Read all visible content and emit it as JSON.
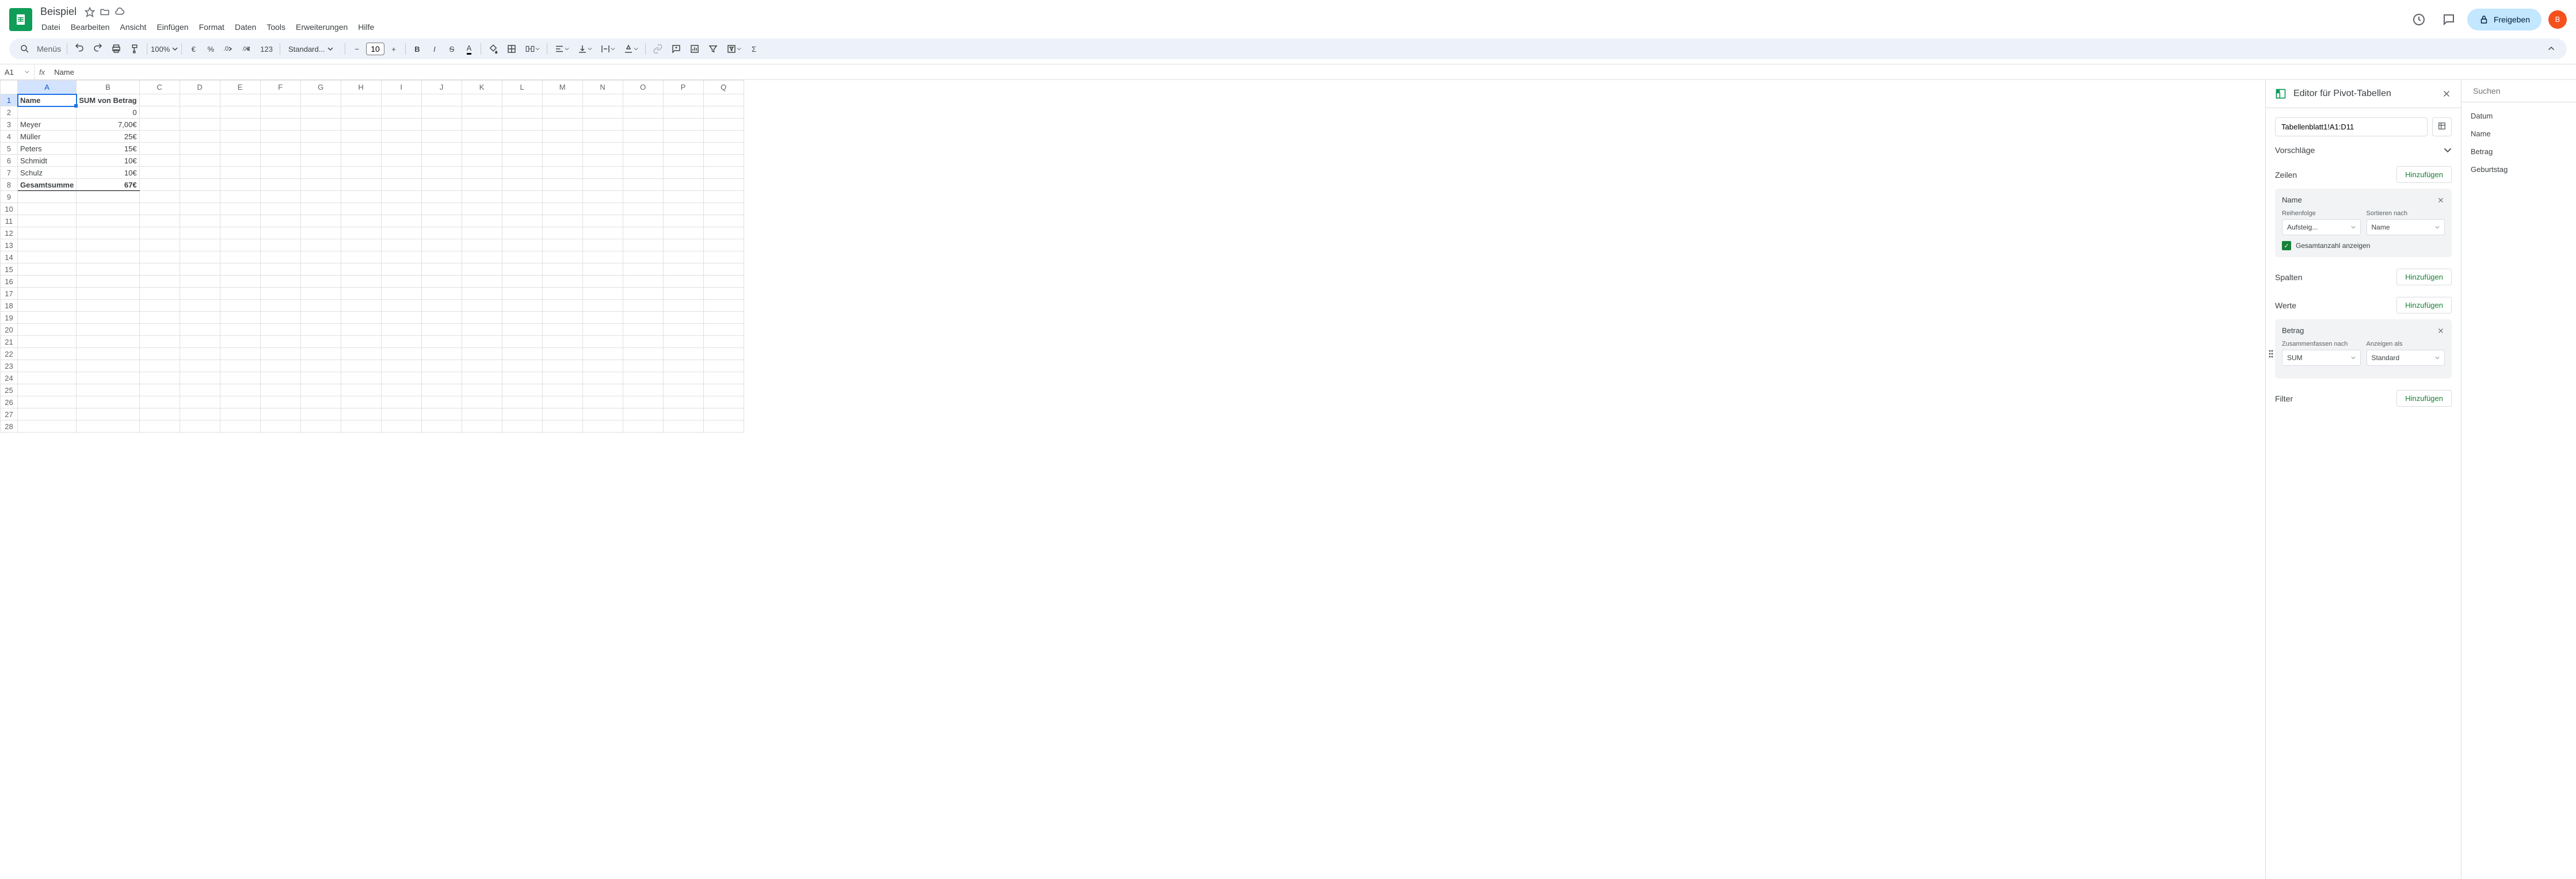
{
  "header": {
    "doc_title": "Beispiel",
    "menus": [
      "Datei",
      "Bearbeiten",
      "Ansicht",
      "Einfügen",
      "Format",
      "Daten",
      "Tools",
      "Erweiterungen",
      "Hilfe"
    ],
    "share_label": "Freigeben",
    "avatar_letter": "B"
  },
  "toolbar": {
    "search_placeholder": "Menüs",
    "zoom": "100%",
    "font": "Standard...",
    "font_size": "10"
  },
  "formula_bar": {
    "name_box": "A1",
    "formula": "Name"
  },
  "columns": [
    "A",
    "B",
    "C",
    "D",
    "E",
    "F",
    "G",
    "H",
    "I",
    "J",
    "K",
    "L",
    "M",
    "N",
    "O",
    "P",
    "Q"
  ],
  "rows": {
    "count": 28,
    "data": [
      {
        "r": 1,
        "a": "Name",
        "b": "SUM von Betrag"
      },
      {
        "r": 2,
        "a": "",
        "b": "0"
      },
      {
        "r": 3,
        "a": "Meyer",
        "b": "7,00€"
      },
      {
        "r": 4,
        "a": "Müller",
        "b": "25€"
      },
      {
        "r": 5,
        "a": "Peters",
        "b": "15€"
      },
      {
        "r": 6,
        "a": "Schmidt",
        "b": "10€"
      },
      {
        "r": 7,
        "a": "Schulz",
        "b": "10€"
      },
      {
        "r": 8,
        "a": "Gesamtsumme",
        "b": "67€"
      }
    ]
  },
  "pivot": {
    "title": "Editor für Pivot-Tabellen",
    "range": "Tabellenblatt1!A1:D11",
    "suggestions_label": "Vorschläge",
    "sections": {
      "rows": {
        "label": "Zeilen",
        "add": "Hinzufügen"
      },
      "cols": {
        "label": "Spalten",
        "add": "Hinzufügen"
      },
      "values": {
        "label": "Werte",
        "add": "Hinzufügen"
      },
      "filter": {
        "label": "Filter",
        "add": "Hinzufügen"
      }
    },
    "row_card": {
      "title": "Name",
      "order_label": "Reihenfolge",
      "order_value": "Aufsteig...",
      "sort_label": "Sortieren nach",
      "sort_value": "Name",
      "totals_label": "Gesamtanzahl anzeigen"
    },
    "value_card": {
      "title": "Betrag",
      "summarize_label": "Zusammenfassen nach",
      "summarize_value": "SUM",
      "display_label": "Anzeigen als",
      "display_value": "Standard"
    }
  },
  "fields": {
    "search_placeholder": "Suchen",
    "items": [
      "Datum",
      "Name",
      "Betrag",
      "Geburtstag"
    ]
  }
}
